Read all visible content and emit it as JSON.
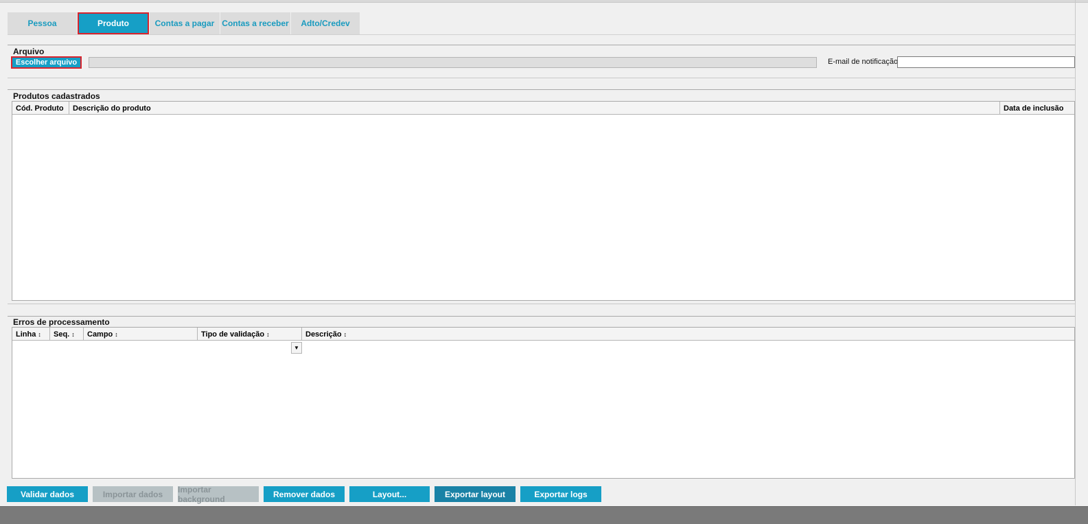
{
  "tabs": [
    {
      "label": "Pessoa"
    },
    {
      "label": "Produto"
    },
    {
      "label": "Contas a pagar"
    },
    {
      "label": "Contas a receber"
    },
    {
      "label": "Adto/Credev"
    }
  ],
  "active_tab": "Produto",
  "arquivo": {
    "title": "Arquivo",
    "choose_button": "Escolher arquivo",
    "file_path_value": "",
    "email_label": "E-mail de notificação",
    "email_value": ""
  },
  "produtos": {
    "title": "Produtos cadastrados",
    "columns": [
      "Cód. Produto",
      "Descrição do produto",
      "Data de inclusão"
    ],
    "rows": []
  },
  "erros": {
    "title": "Erros de processamento",
    "columns": [
      "Linha",
      "Seq.",
      "Campo",
      "Tipo de validação",
      "Descrição"
    ],
    "sort_icon": "sort-updown-icon",
    "rows": []
  },
  "buttons": {
    "validar": "Validar dados",
    "importar": "Importar dados",
    "importar_bg": "Importar background",
    "remover": "Remover dados",
    "layout": "Layout...",
    "exportar_layout": "Exportar layout",
    "exportar_logs": "Exportar logs"
  },
  "colors": {
    "accent": "#169fc6",
    "highlight": "#d9232d",
    "disabled": "#b7c1c4"
  }
}
